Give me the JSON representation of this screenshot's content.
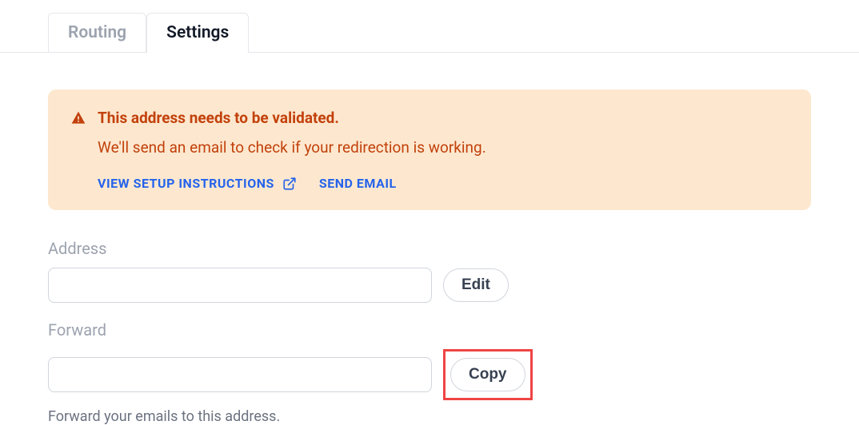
{
  "tabs": {
    "routing": "Routing",
    "settings": "Settings"
  },
  "alert": {
    "title": "This address needs to be validated.",
    "body": "We'll send an email to check if your redirection is working.",
    "viewInstructions": "VIEW SETUP INSTRUCTIONS",
    "sendEmail": "SEND EMAIL"
  },
  "fields": {
    "address": {
      "label": "Address",
      "value": "",
      "button": "Edit"
    },
    "forward": {
      "label": "Forward",
      "value": "",
      "button": "Copy",
      "help": "Forward your emails to this address."
    }
  }
}
